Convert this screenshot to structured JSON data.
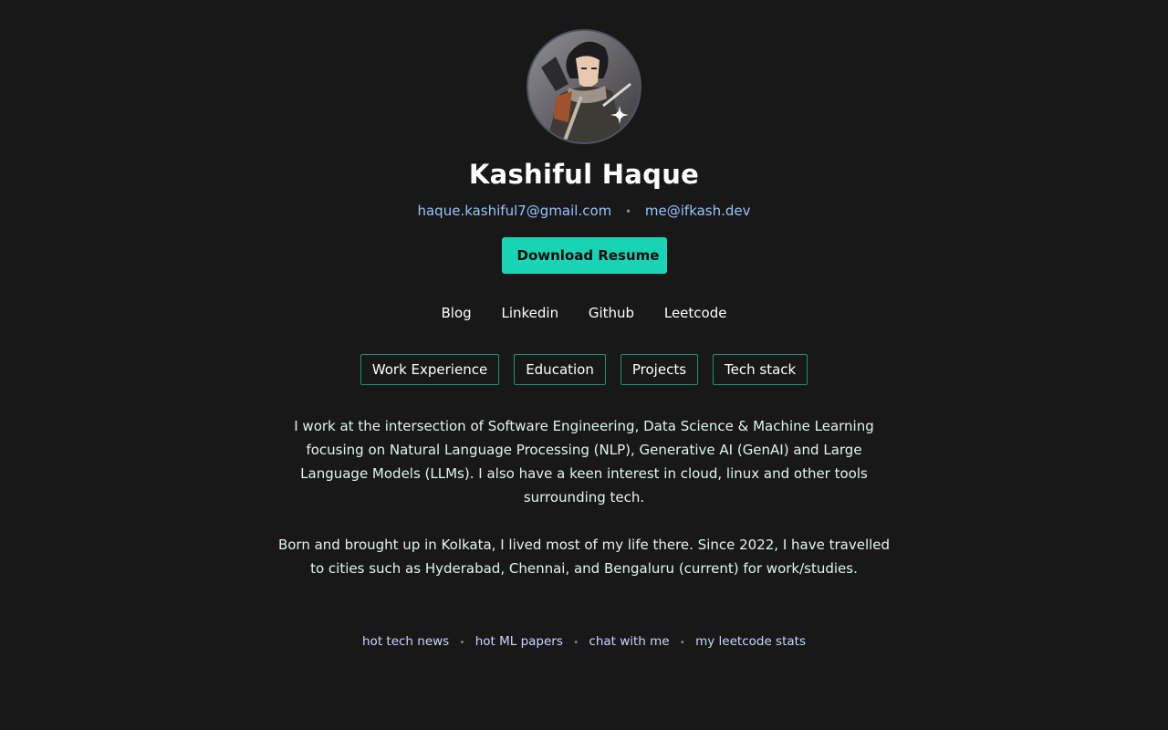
{
  "profile": {
    "name": "Kashiful Haque",
    "avatar_icon": "profile-avatar"
  },
  "contact": {
    "email_primary": "haque.kashiful7@gmail.com",
    "separator": "•",
    "email_secondary": "me@ifkash.dev"
  },
  "resume_button": "Download Resume",
  "social_links": [
    "Blog",
    "Linkedin",
    "Github",
    "Leetcode"
  ],
  "tabs": [
    "Work Experience",
    "Education",
    "Projects",
    "Tech stack"
  ],
  "bio": {
    "paragraph_1": "I work at the intersection of Software Engineering, Data Science & Machine Learning focusing on Natural Language Processing (NLP), Generative AI (GenAI) and Large Language Models (LLMs). I also have a keen interest in cloud, linux and other tools surrounding tech.",
    "paragraph_2": "Born and brought up in Kolkata, I lived most of my life there. Since 2022, I have travelled to cities such as Hyderabad, Chennai, and Bengaluru (current) for work/studies."
  },
  "footer_links": [
    "hot tech news",
    "hot ML papers",
    "chat with me",
    "my leetcode stats"
  ],
  "footer_separator": "•",
  "colors": {
    "background": "#181818",
    "accent": "#19d3b5",
    "link": "#93c5fd",
    "tab_border": "#1f8f7e"
  }
}
